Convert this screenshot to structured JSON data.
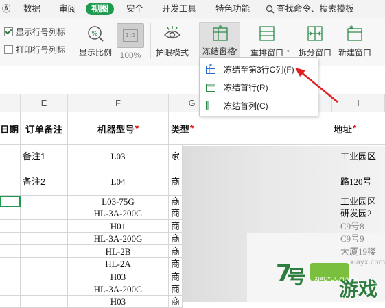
{
  "menubar": {
    "tabs": [
      "Ⓐ",
      "数据",
      "审阅",
      "视图",
      "安全",
      "开发工具",
      "特色功能"
    ],
    "active_tab": "视图",
    "search_label": "查找命令、搜索模板"
  },
  "ribbon": {
    "checkbox_row_header": "显示行号列标",
    "checkbox_print_header": "打印行号列标",
    "zoom_label": "显示比例",
    "zoom_100_label": "100%",
    "zoom_box_text": "1:1",
    "eye_mode_label": "护眼模式",
    "freeze_label": "冻结窗格",
    "rearrange_label": "重排窗口",
    "split_label": "拆分窗口",
    "new_window_label": "新建窗口"
  },
  "dropdown": {
    "items": [
      "冻结至第3行C列(F)",
      "冻结首行(R)",
      "冻结首列(C)"
    ]
  },
  "grid": {
    "columns": [
      "",
      "E",
      "F",
      "G",
      "",
      "I"
    ],
    "header_row": {
      "d": "日期",
      "e": "订单备注",
      "f": "机器型号",
      "g": "类型",
      "i": "地址",
      "required_mark": "*"
    },
    "rows": [
      {
        "e": "备注1",
        "f": "L03",
        "g": "家",
        "i": "工业园区"
      },
      {
        "e": "备注2",
        "f": "L04",
        "g": "商",
        "i": "路120号"
      },
      {
        "e": "",
        "f": "L03-75G",
        "g": "商",
        "i": "工业园区"
      },
      {
        "e": "",
        "f": "HL-3A-200G",
        "g": "商",
        "i": "研发园2"
      },
      {
        "e": "",
        "f": "H01",
        "g": "商",
        "i": "C9号8"
      },
      {
        "e": "",
        "f": "HL-3A-200G",
        "g": "商",
        "i": "C9号9"
      },
      {
        "e": "",
        "f": "HL-2B",
        "g": "商",
        "i": "大厦19楼"
      },
      {
        "e": "",
        "f": "HL-2A",
        "g": "商",
        "i": ""
      },
      {
        "e": "",
        "f": "H03",
        "g": "商",
        "i": "号"
      },
      {
        "e": "",
        "f": "HL-3A-200G",
        "g": "商",
        "i": ""
      },
      {
        "e": "",
        "f": "H03",
        "g": "商",
        "i": ""
      }
    ]
  },
  "watermark": {
    "site": "xiayx.com",
    "brand": "游戏",
    "sub": "XIAOYOUXIWANG"
  },
  "colors": {
    "accent_green": "#1e9b4e",
    "required_red": "#dd1111",
    "arrow_red": "#e02020",
    "icon_blue": "#2a6fc9"
  }
}
